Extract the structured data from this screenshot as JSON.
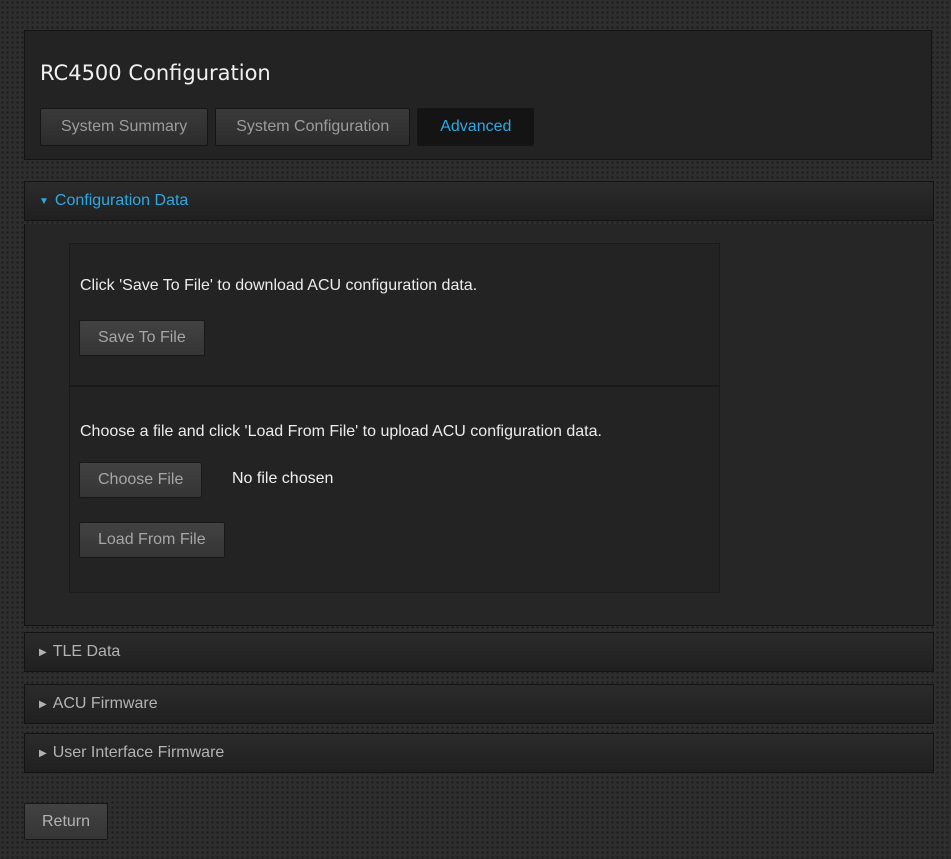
{
  "header": {
    "title": "RC4500 Configuration",
    "tabs": [
      {
        "label": "System Summary",
        "active": false
      },
      {
        "label": "System Configuration",
        "active": false
      },
      {
        "label": "Advanced",
        "active": true
      }
    ]
  },
  "sections": [
    {
      "label": "Configuration Data",
      "expanded": true
    },
    {
      "label": "TLE Data",
      "expanded": false
    },
    {
      "label": "ACU Firmware",
      "expanded": false
    },
    {
      "label": "User Interface Firmware",
      "expanded": false
    }
  ],
  "config_data": {
    "save_description": "Click 'Save To File' to download ACU configuration data.",
    "save_button": "Save To File",
    "load_description": "Choose a file and click 'Load From File' to upload ACU configuration data.",
    "choose_file_button": "Choose File",
    "file_status": "No file chosen",
    "load_button": "Load From File"
  },
  "footer": {
    "return_button": "Return"
  },
  "icons": {
    "expanded": "caret-down-icon",
    "collapsed": "caret-right-icon"
  },
  "colors": {
    "accent": "#2fa8e2",
    "panel": "#232323",
    "background": "#2e2e2e"
  }
}
